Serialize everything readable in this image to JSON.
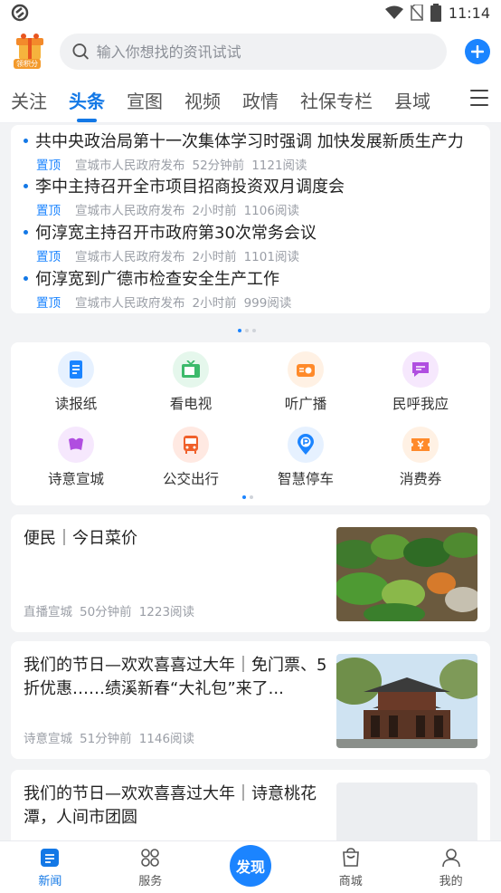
{
  "status": {
    "time": "11:14"
  },
  "header": {
    "logo_label": "领积分",
    "search_placeholder": "输入你想找的资讯试试"
  },
  "tabs": [
    "关注",
    "头条",
    "宣图",
    "视频",
    "政情",
    "社保专栏",
    "县域"
  ],
  "top_news": [
    {
      "title": "共中央政治局第十一次集体学习时强调  加快发展新质生产力",
      "pin": "置顶",
      "source": "宣城市人民政府发布",
      "time": "52分钟前",
      "reads": "1121阅读"
    },
    {
      "title": "李中主持召开全市项目招商投资双月调度会",
      "pin": "置顶",
      "source": "宣城市人民政府发布",
      "time": "2小时前",
      "reads": "1106阅读"
    },
    {
      "title": "何淳宽主持召开市政府第30次常务会议",
      "pin": "置顶",
      "source": "宣城市人民政府发布",
      "time": "2小时前",
      "reads": "1101阅读"
    },
    {
      "title": "何淳宽到广德市检查安全生产工作",
      "pin": "置顶",
      "source": "宣城市人民政府发布",
      "time": "2小时前",
      "reads": "999阅读"
    }
  ],
  "services": [
    {
      "label": "读报纸",
      "icon": "newspaper-icon",
      "color": "#1b84ff"
    },
    {
      "label": "看电视",
      "icon": "tv-icon",
      "color": "#3cba6b"
    },
    {
      "label": "听广播",
      "icon": "radio-icon",
      "color": "#ff8a2a"
    },
    {
      "label": "民呼我应",
      "icon": "message-icon",
      "color": "#b04ee0"
    },
    {
      "label": "诗意宣城",
      "icon": "poetry-icon",
      "color": "#b04ee0"
    },
    {
      "label": "公交出行",
      "icon": "bus-icon",
      "color": "#f0602a"
    },
    {
      "label": "智慧停车",
      "icon": "parking-icon",
      "color": "#1b84ff"
    },
    {
      "label": "消费券",
      "icon": "coupon-icon",
      "color": "#ff8a2a"
    }
  ],
  "articles": [
    {
      "title": "便民｜今日菜价",
      "source": "直播宣城",
      "time": "50分钟前",
      "reads": "1223阅读"
    },
    {
      "title": "我们的节日—欢欢喜喜过大年｜免门票、5折优惠……绩溪新春“大礼包”来了...",
      "source": "诗意宣城",
      "time": "51分钟前",
      "reads": "1146阅读"
    },
    {
      "title": "我们的节日—欢欢喜喜过大年｜诗意桃花潭，人间市团圆",
      "source": "",
      "time": "",
      "reads": ""
    }
  ],
  "bottom_nav": [
    {
      "label": "新闻",
      "icon": "news-icon"
    },
    {
      "label": "服务",
      "icon": "services-icon"
    },
    {
      "label": "发现",
      "icon": "discover-icon"
    },
    {
      "label": "商城",
      "icon": "shop-icon"
    },
    {
      "label": "我的",
      "icon": "profile-icon"
    }
  ],
  "colors": {
    "accent": "#1378e6",
    "background": "#f2f3f5"
  }
}
